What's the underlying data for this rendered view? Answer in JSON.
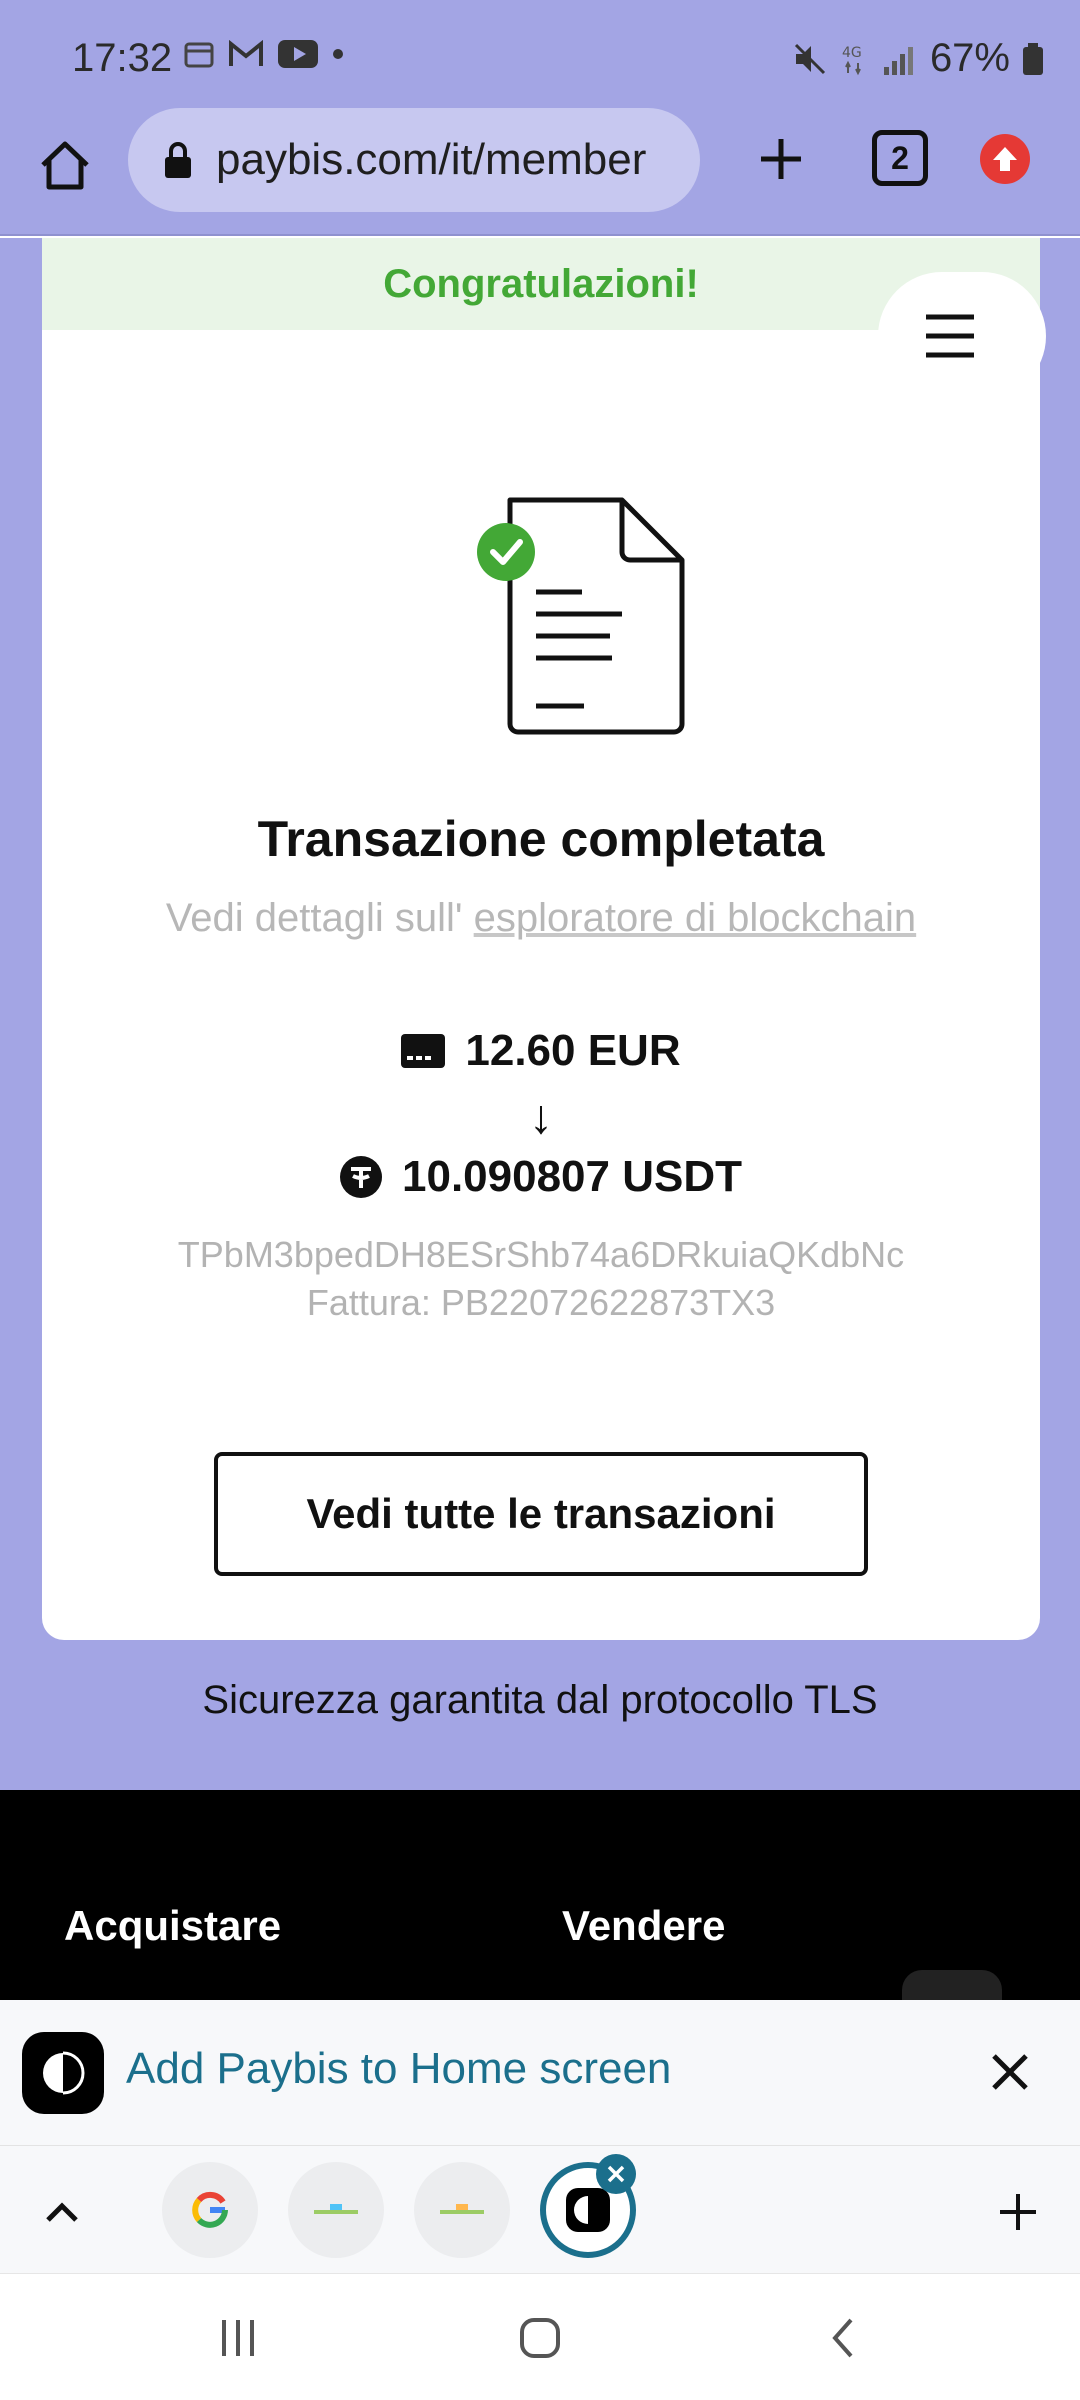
{
  "status_bar": {
    "time": "17:32",
    "battery": "67%",
    "network": "4G"
  },
  "browser": {
    "url": "paybis.com/it/member",
    "tab_count": "2",
    "icons": {
      "home": "home-icon",
      "lock": "lock-icon",
      "new_tab": "plus-icon",
      "update": "arrow-up-circle-icon"
    }
  },
  "card": {
    "banner": "Congratulazioni!",
    "title": "Transazione completata",
    "subtitle_prefix": "Vedi dettagli sull'",
    "subtitle_link": "esploratore di blockchain",
    "send_amount": "12.60 EUR",
    "receive_amount": "10.090807 USDT",
    "arrow": "↓",
    "wallet_address": "TPbM3bpedDH8ESrShb74a6DRkuiaQKdbNc",
    "invoice": "Fattura: PB22072622873TX3",
    "cta_label": "Vedi tutte le transazioni"
  },
  "tls_note": "Sicurezza garantita dal protocollo TLS",
  "footer": {
    "col1": "Acquistare",
    "col2": "Vendere"
  },
  "a2hs": {
    "label": "Add Paybis to Home screen"
  },
  "colors": {
    "page_bg": "#a3a5e4",
    "success_green": "#43a836",
    "accent_teal": "#1b6f8c"
  }
}
